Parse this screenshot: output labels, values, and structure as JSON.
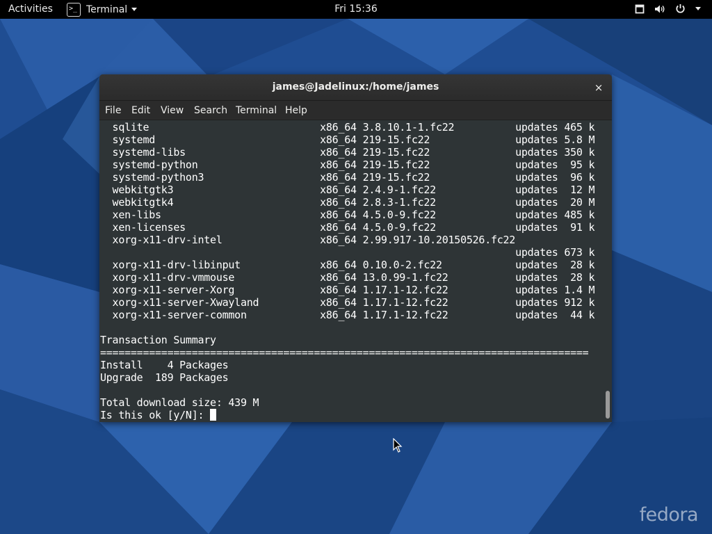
{
  "topbar": {
    "activities_label": "Activities",
    "app_icon_glyph": ">_",
    "app_name": "Terminal",
    "clock": "Fri 15:36"
  },
  "window": {
    "title": "james@Jadelinux:/home/james",
    "close_glyph": "×"
  },
  "menubar": {
    "items": [
      "File",
      "Edit",
      "View",
      "Search",
      "Terminal",
      "Help"
    ]
  },
  "terminal": {
    "lines": [
      "  sqlite                            x86_64 3.8.10.1-1.fc22          updates 465 k",
      "  systemd                           x86_64 219-15.fc22              updates 5.8 M",
      "  systemd-libs                      x86_64 219-15.fc22              updates 350 k",
      "  systemd-python                    x86_64 219-15.fc22              updates  95 k",
      "  systemd-python3                   x86_64 219-15.fc22              updates  96 k",
      "  webkitgtk3                        x86_64 2.4.9-1.fc22             updates  12 M",
      "  webkitgtk4                        x86_64 2.8.3-1.fc22             updates  20 M",
      "  xen-libs                          x86_64 4.5.0-9.fc22             updates 485 k",
      "  xen-licenses                      x86_64 4.5.0-9.fc22             updates  91 k",
      "  xorg-x11-drv-intel                x86_64 2.99.917-10.20150526.fc22",
      "                                                                    updates 673 k",
      "  xorg-x11-drv-libinput             x86_64 0.10.0-2.fc22            updates  28 k",
      "  xorg-x11-drv-vmmouse              x86_64 13.0.99-1.fc22           updates  28 k",
      "  xorg-x11-server-Xorg              x86_64 1.17.1-12.fc22           updates 1.4 M",
      "  xorg-x11-server-Xwayland          x86_64 1.17.1-12.fc22           updates 912 k",
      "  xorg-x11-server-common            x86_64 1.17.1-12.fc22           updates  44 k",
      "",
      "Transaction Summary",
      "================================================================================",
      "Install    4 Packages",
      "Upgrade  189 Packages",
      "",
      "Total download size: 439 M"
    ],
    "prompt": "Is this ok [y/N]: "
  },
  "branding": {
    "logo_text": "fedora"
  },
  "colors": {
    "terminal_bg": "#2e3436",
    "terminal_fg": "#ffffff",
    "wallpaper": "#1d4a8c",
    "topbar_bg": "#000000"
  }
}
